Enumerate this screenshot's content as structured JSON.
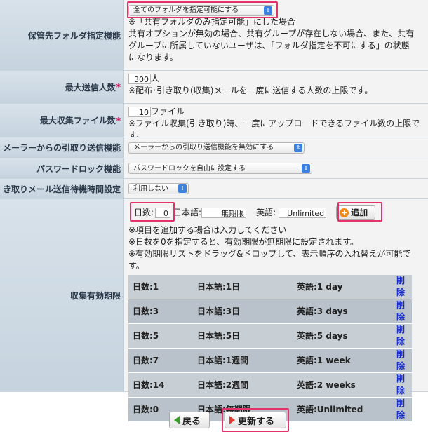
{
  "folder": {
    "label": "保管先フォルダ指定機能",
    "select": "全てのフォルダを指定可能にする",
    "notes": [
      "※「共有フォルダのみ指定可能」にした場合",
      "共有オプションが無効の場合、共有グループが存在しない場合、また、共有",
      "グループに所属していないユーザは、「フォルダ指定を不可にする」の状態",
      "になります。"
    ]
  },
  "max_send": {
    "label": "最大送信人数",
    "required": "*",
    "value": "300",
    "unit": "人",
    "note": "※配布･引き取り(収集)メールを一度に送信する人数の上限です。"
  },
  "max_files": {
    "label": "最大収集ファイル数",
    "required": "*",
    "value": "10",
    "unit": "ファイル",
    "note": "※ファイル収集(引き取り)時、一度にアップロードできるファイル数の上限です。"
  },
  "mailer_pickup": {
    "label": "メーラーからの引取り送信機能",
    "select": "メーラーからの引取り送信機能を無効にする"
  },
  "password_lock": {
    "label": "パスワードロック機能",
    "select": "パスワードロックを自由に設定する"
  },
  "pickup_wait": {
    "label": "き取りメール送信待機時間設定",
    "select": "利用しない"
  },
  "expiry": {
    "label": "収集有効期限",
    "days_label": "日数:",
    "days_value": "0",
    "ja_label": "日本語:",
    "ja_value": "無期限",
    "en_label": "英語:",
    "en_value": "Unlimited",
    "add_label": "追加",
    "notes": [
      "※項目を追加する場合は入力してください",
      "※日数を0を指定すると、有効期限が無期限に設定されます。",
      "※有効期限リストをドラッグ&ドロップして、表示順序の入れ替えが可能です。"
    ],
    "rows": [
      {
        "days": "日数:1",
        "ja": "日本語:1日",
        "en": "英語:1 day",
        "del": "削除"
      },
      {
        "days": "日数:3",
        "ja": "日本語:3日",
        "en": "英語:3 days",
        "del": "削除"
      },
      {
        "days": "日数:5",
        "ja": "日本語:5日",
        "en": "英語:5 days",
        "del": "削除"
      },
      {
        "days": "日数:7",
        "ja": "日本語:1週間",
        "en": "英語:1 week",
        "del": "削除"
      },
      {
        "days": "日数:14",
        "ja": "日本語:2週間",
        "en": "英語:2 weeks",
        "del": "削除"
      },
      {
        "days": "日数:0",
        "ja": "日本語:無期限",
        "en": "英語:Unlimited",
        "del": "削除"
      }
    ]
  },
  "buttons": {
    "back": "戻る",
    "update": "更新する"
  },
  "colors": {
    "highlight": "#e2336b",
    "link": "#1a2fd0",
    "required": "#d1004d"
  }
}
